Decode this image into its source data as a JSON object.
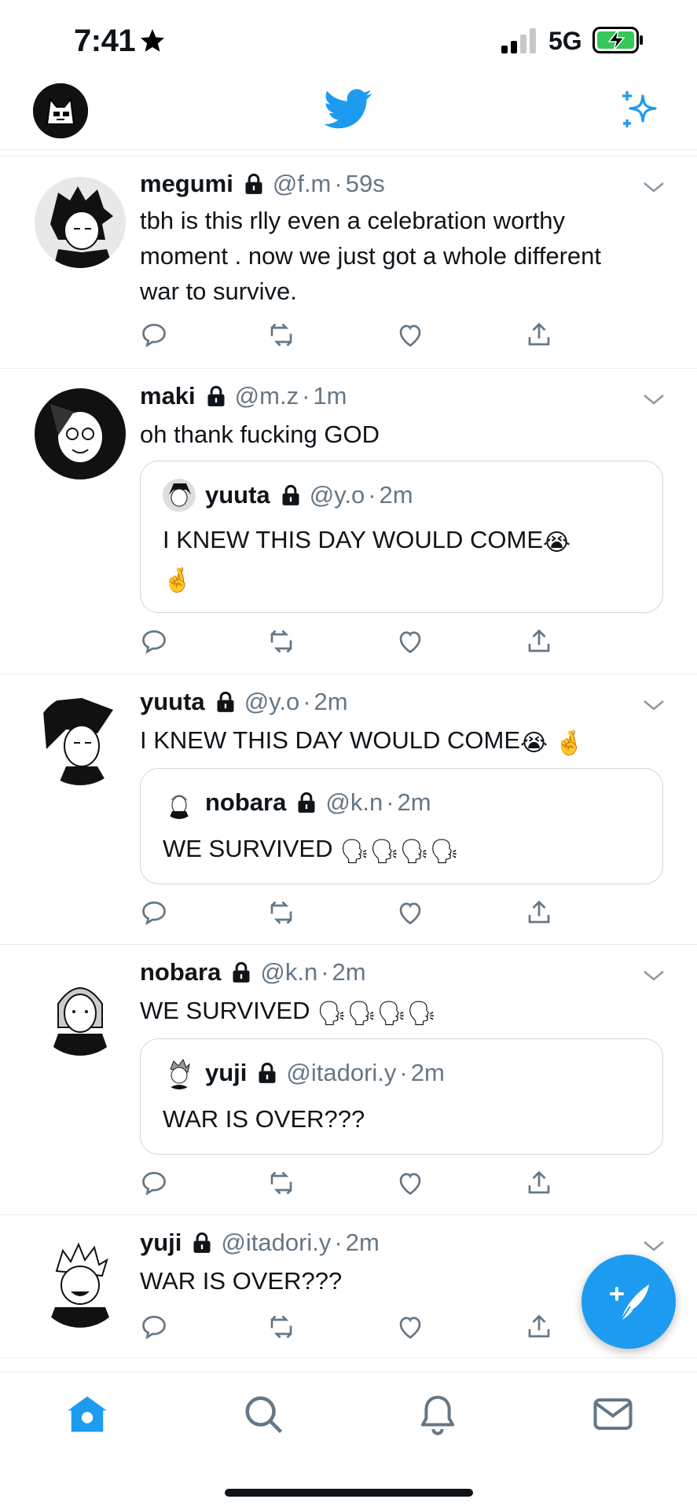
{
  "status": {
    "time": "7:41",
    "network": "5G"
  },
  "colors": {
    "accent": "#1d9bf0",
    "secondary": "#657786",
    "border": "#e6ecf0",
    "battery": "#34c759"
  },
  "icons": [
    "star-icon",
    "signal-icon",
    "battery-charging-icon",
    "twitter-bird-icon",
    "sparkle-icon",
    "lock-icon",
    "chevron-down-icon",
    "reply-icon",
    "retweet-icon",
    "like-icon",
    "share-icon",
    "compose-icon",
    "home-icon",
    "search-icon",
    "notifications-icon",
    "messages-icon"
  ],
  "tweets": [
    {
      "name": "megumi",
      "handle": "@f.m",
      "dot": "·",
      "time": "59s",
      "text": "tbh is this rlly even a celebration worthy moment . now we just got a whole different war to survive."
    },
    {
      "name": "maki",
      "handle": "@m.z",
      "dot": "·",
      "time": "1m",
      "text": "oh thank fucking GOD",
      "quote": {
        "name": "yuuta",
        "handle": "@y.o",
        "dot": "·",
        "time": "2m",
        "text": "I KNEW THIS DAY WOULD COME",
        "emoji1": "😭",
        "emoji2": "🤞"
      }
    },
    {
      "name": "yuuta",
      "handle": "@y.o",
      "dot": "·",
      "time": "2m",
      "text": "I KNEW THIS DAY WOULD COME",
      "emoji1": "😭",
      "emoji2": "🤞",
      "quote": {
        "name": "nobara",
        "handle": "@k.n",
        "dot": "·",
        "time": "2m",
        "text": "WE SURVIVED",
        "emoji1": "🗣🗣🗣🗣"
      }
    },
    {
      "name": "nobara",
      "handle": "@k.n",
      "dot": "·",
      "time": "2m",
      "text": "WE SURVIVED",
      "emoji1": "🗣🗣🗣🗣",
      "quote": {
        "name": "yuji",
        "handle": "@itadori.y",
        "dot": "·",
        "time": "2m",
        "text": "WAR IS OVER???"
      }
    },
    {
      "name": "yuji",
      "handle": "@itadori.y",
      "dot": "·",
      "time": "2m",
      "text": "WAR IS OVER???"
    }
  ]
}
